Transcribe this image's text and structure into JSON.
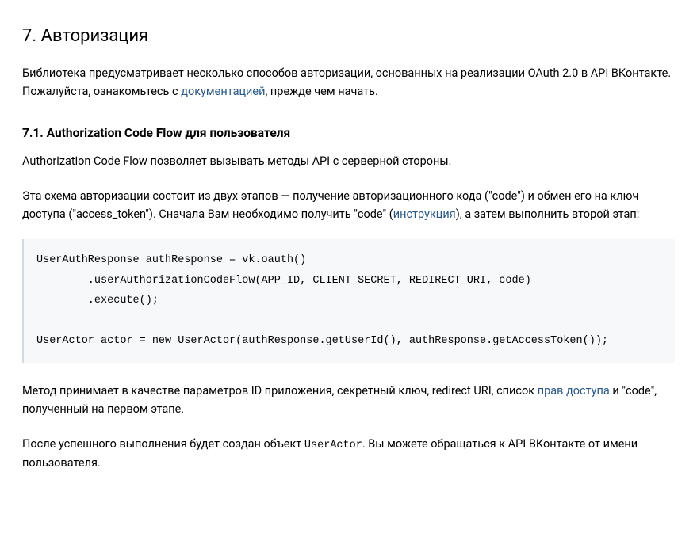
{
  "section": {
    "number": "7.",
    "title": "Авторизация",
    "intro_before_link": "Библиотека предусматривает несколько способов авторизации, основанных на реализации OAuth 2.0 в API ВКонтакте. Пожалуйста, ознакомьтесь с ",
    "intro_link": "документацией",
    "intro_after_link": ", прежде чем начать."
  },
  "subsection": {
    "number": "7.1.",
    "title": "Authorization Code Flow для пользователя",
    "p1": "Authorization Code Flow позволяет вызывать методы API с серверной стороны.",
    "p2_before_link": "Эта схема авторизации состоит из двух этапов — получение авторизационного кода (\"code\") и обмен его на ключ доступа (\"access_token\"). Сначала Вам необходимо получить \"code\" (",
    "p2_link": "инструкция",
    "p2_after_link": "), а затем выполнить второй этап:",
    "code": "UserAuthResponse authResponse = vk.oauth()\n        .userAuthorizationCodeFlow(APP_ID, CLIENT_SECRET, REDIRECT_URI, code)\n        .execute();\n\nUserActor actor = new UserActor(authResponse.getUserId(), authResponse.getAccessToken());",
    "p3_before_link": "Метод принимает в качестве параметров ID приложения, секретный ключ, redirect URI, список ",
    "p3_link": "прав доступа",
    "p3_after_link": " и \"code\", полученный на первом этапе.",
    "p4_before_code": "После успешного выполнения будет создан объект ",
    "p4_code": "UserActor",
    "p4_after_code": ". Вы можете обращаться к API ВКонтакте от имени пользователя."
  }
}
